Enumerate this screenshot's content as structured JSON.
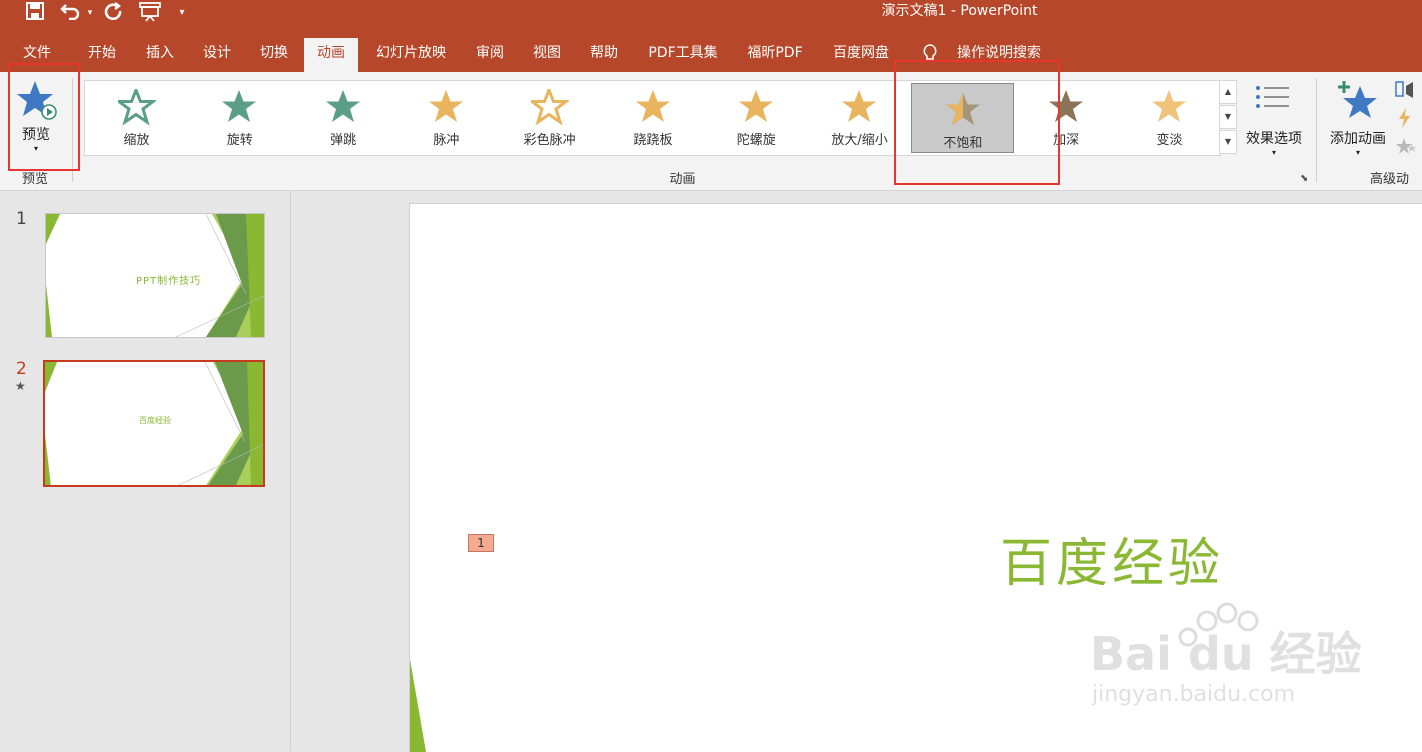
{
  "window": {
    "title": "演示文稿1  -  PowerPoint"
  },
  "tabs": [
    "文件",
    "开始",
    "插入",
    "设计",
    "切换",
    "动画",
    "幻灯片放映",
    "审阅",
    "视图",
    "帮助",
    "PDF工具集",
    "福昕PDF",
    "百度网盘"
  ],
  "active_tab": "动画",
  "tell_me": {
    "label": "操作说明搜索"
  },
  "ribbon": {
    "preview": {
      "button_label": "预览",
      "group_label": "预览"
    },
    "animation_group_label": "动画",
    "animations": [
      {
        "label": "缩放",
        "icon": "zoom-star-icon",
        "color": "#5a9e87"
      },
      {
        "label": "旋转",
        "icon": "spin-star-icon",
        "color": "#5a9e87"
      },
      {
        "label": "弹跳",
        "icon": "bounce-star-icon",
        "color": "#5a9e87"
      },
      {
        "label": "脉冲",
        "icon": "pulse-star-icon",
        "color": "#e9b45e"
      },
      {
        "label": "彩色脉冲",
        "icon": "color-pulse-star-icon",
        "color": "#e9b45e"
      },
      {
        "label": "跷跷板",
        "icon": "teeter-star-icon",
        "color": "#e9b45e"
      },
      {
        "label": "陀螺旋",
        "icon": "spin-arrow-star-icon",
        "color": "#e9b45e"
      },
      {
        "label": "放大/缩小",
        "icon": "grow-shrink-star-icon",
        "color": "#e9b45e"
      },
      {
        "label": "不饱和",
        "icon": "desaturate-star-icon",
        "color": "#c8a870",
        "selected": true
      },
      {
        "label": "加深",
        "icon": "darken-star-icon",
        "color": "#8a7558"
      },
      {
        "label": "变淡",
        "icon": "lighten-star-icon",
        "color": "#f0c27a"
      }
    ],
    "effect_options_label": "效果选项",
    "add_animation_label": "添加动画",
    "advanced_group_label": "高级动"
  },
  "slides": [
    {
      "number": "1",
      "title": "PPT制作技巧"
    },
    {
      "number": "2",
      "title": "百度经验",
      "has_animation_marker": true
    }
  ],
  "current_slide": {
    "title": "百度经验",
    "animation_tag": "1"
  },
  "watermark": {
    "brand": "Bai du 经验",
    "url": "jingyan.baidu.com"
  },
  "colors": {
    "accent": "#b7472a",
    "slide_text": "#8ab832",
    "highlight": "#e8352e",
    "star_blue": "#3f78c3"
  }
}
